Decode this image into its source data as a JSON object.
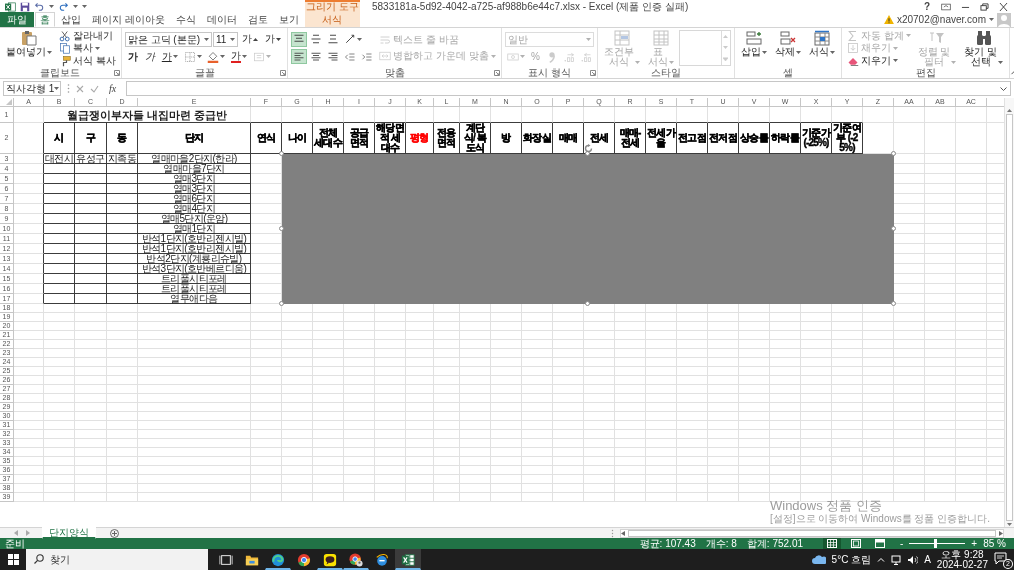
{
  "title_bar": {
    "title": "5833181a-5d92-4042-a725-af988b6e44c7.xlsx - Excel (제품 인증 실패)",
    "context_label": "그리기 도구",
    "help": "?"
  },
  "tabs": [
    {
      "label": "파일",
      "kind": "file",
      "selected": false
    },
    {
      "label": "홈",
      "kind": "normal",
      "selected": true
    },
    {
      "label": "삽입",
      "kind": "normal",
      "selected": false
    },
    {
      "label": "페이지 레이아웃",
      "kind": "normal",
      "selected": false
    },
    {
      "label": "수식",
      "kind": "normal",
      "selected": false
    },
    {
      "label": "데이터",
      "kind": "normal",
      "selected": false
    },
    {
      "label": "검토",
      "kind": "normal",
      "selected": false
    },
    {
      "label": "보기",
      "kind": "normal",
      "selected": false
    },
    {
      "label": "서식",
      "kind": "contextual",
      "selected": false
    }
  ],
  "account": {
    "user": "x20702@naver.com"
  },
  "ribbon": {
    "groups": [
      {
        "label": "클립보드",
        "launcher": true,
        "columns": [
          [
            [
              {
                "kind": "large",
                "label": "붙여넣기",
                "dropdown": true,
                "disabled": false
              }
            ]
          ],
          [
            [
              {
                "kind": "small",
                "label": "잘라내기",
                "dropdown": false,
                "disabled": false
              }
            ],
            [
              {
                "kind": "small",
                "label": "복사",
                "dropdown": true,
                "disabled": false
              }
            ],
            [
              {
                "kind": "small",
                "label": "서식 복사",
                "dropdown": false,
                "disabled": false
              }
            ]
          ]
        ]
      },
      {
        "label": "글꼴",
        "launcher": true,
        "columns": [
          [
            [
              {
                "kind": "field",
                "value": "맑은 고딕 (본문)",
                "disabled": false
              },
              {
                "kind": "field",
                "value": "11",
                "disabled": false
              },
              {
                "kind": "grow",
                "label": "가",
                "dropdown": false,
                "disabled": false
              },
              {
                "kind": "shrink",
                "label": "가",
                "dropdown": false,
                "disabled": false
              }
            ],
            [
              {
                "kind": "bold",
                "label": "가",
                "dropdown": false,
                "disabled": false
              },
              {
                "kind": "italic",
                "label": "가",
                "dropdown": false,
                "disabled": false
              },
              {
                "kind": "underline",
                "label": "가",
                "dropdown": true,
                "disabled": false
              },
              {
                "kind": "icon",
                "dropdown": true,
                "disabled": false,
                "selected": false
              },
              {
                "kind": "icon",
                "dropdown": true,
                "disabled": false,
                "selected": false
              },
              {
                "kind": "fontcolor",
                "label": "가",
                "dropdown": true,
                "disabled": false
              },
              {
                "kind": "icon",
                "dropdown": true,
                "disabled": true,
                "selected": false
              }
            ]
          ]
        ]
      },
      {
        "label": "맞춤",
        "launcher": true,
        "columns": [
          [
            [
              {
                "kind": "icon",
                "dropdown": false,
                "disabled": false,
                "selected": true
              },
              {
                "kind": "icon",
                "dropdown": false,
                "disabled": false,
                "selected": false
              },
              {
                "kind": "icon",
                "dropdown": false,
                "disabled": false,
                "selected": false
              },
              {
                "kind": "icon",
                "dropdown": true,
                "disabled": false,
                "selected": false
              }
            ],
            [
              {
                "kind": "icon",
                "dropdown": false,
                "disabled": false,
                "selected": true
              },
              {
                "kind": "icon",
                "dropdown": false,
                "disabled": false,
                "selected": false
              },
              {
                "kind": "icon",
                "dropdown": false,
                "disabled": false,
                "selected": false
              },
              {
                "kind": "icon",
                "dropdown": false,
                "disabled": false,
                "selected": false
              },
              {
                "kind": "icon",
                "dropdown": false,
                "disabled": false,
                "selected": false
              }
            ]
          ],
          [
            [
              {
                "kind": "small",
                "label": "텍스트 줄 바꿈",
                "dropdown": false,
                "disabled": true
              }
            ],
            [
              {
                "kind": "small",
                "label": "병합하고 가운데 맞춤",
                "dropdown": true,
                "disabled": true
              }
            ]
          ]
        ]
      },
      {
        "label": "표시 형식",
        "launcher": true,
        "columns": [
          [
            [
              {
                "kind": "field",
                "value": "일반",
                "disabled": true
              }
            ],
            [
              {
                "kind": "icon",
                "dropdown": true,
                "disabled": true,
                "selected": false
              },
              {
                "kind": "symbol",
                "label": "%",
                "dropdown": false,
                "disabled": true
              },
              {
                "kind": "icon",
                "dropdown": false,
                "disabled": true,
                "selected": false
              },
              {
                "kind": "icon",
                "dropdown": false,
                "disabled": true,
                "selected": false
              },
              {
                "kind": "icon",
                "dropdown": false,
                "disabled": true,
                "selected": false
              }
            ]
          ]
        ]
      },
      {
        "label": "스타일",
        "launcher": false,
        "columns": [
          [
            [
              {
                "kind": "large",
                "label": "조건부\n서식",
                "dropdown": true,
                "disabled": true
              }
            ]
          ],
          [
            [
              {
                "kind": "large",
                "label": "표\n서식",
                "dropdown": true,
                "disabled": true
              }
            ]
          ],
          [
            [
              {
                "kind": "gallery",
                "disabled": true
              }
            ]
          ]
        ]
      },
      {
        "label": "셀",
        "launcher": false,
        "columns": [
          [
            [
              {
                "kind": "large",
                "label": "삽입",
                "dropdown": true,
                "disabled": false
              }
            ]
          ],
          [
            [
              {
                "kind": "large",
                "label": "삭제",
                "dropdown": true,
                "disabled": false
              }
            ]
          ],
          [
            [
              {
                "kind": "large",
                "label": "서식",
                "dropdown": true,
                "disabled": false
              }
            ]
          ]
        ]
      },
      {
        "label": "편집",
        "launcher": false,
        "columns": [
          [
            [
              {
                "kind": "small",
                "label": "자동 합계",
                "dropdown": true,
                "disabled": true
              }
            ],
            [
              {
                "kind": "small",
                "label": "채우기",
                "dropdown": true,
                "disabled": true
              }
            ],
            [
              {
                "kind": "small",
                "label": "지우기",
                "dropdown": true,
                "disabled": false
              }
            ]
          ],
          [
            [
              {
                "kind": "large",
                "label": "정렬 및\n필터",
                "dropdown": true,
                "disabled": true
              }
            ]
          ],
          [
            [
              {
                "kind": "large",
                "label": "찾기 및\n선택",
                "dropdown": true,
                "disabled": false
              }
            ]
          ]
        ]
      }
    ]
  },
  "formula_bar": {
    "name_box": "직사각형 1",
    "function_label": "fx"
  },
  "sheet": {
    "columns": [
      "A",
      "B",
      "C",
      "D",
      "E",
      "F",
      "G",
      "H",
      "I",
      "J",
      "K",
      "L",
      "M",
      "N",
      "O",
      "P",
      "Q",
      "R",
      "S",
      "T",
      "U",
      "V",
      "W",
      "X",
      "Y",
      "Z",
      "AA",
      "AB",
      "AC"
    ],
    "title_row": {
      "number": "1",
      "title": "월급쟁이부자들 내집마련 중급반"
    },
    "header_row": {
      "number": "2",
      "headers": [
        {
          "text": "시",
          "color": "#000000"
        },
        {
          "text": "구",
          "color": "#000000"
        },
        {
          "text": "동",
          "color": "#000000"
        },
        {
          "text": "단지",
          "color": "#000000"
        },
        {
          "text": "연식",
          "color": "#000000"
        },
        {
          "text": "나이",
          "color": "#000000"
        },
        {
          "text": "전체 세대수",
          "color": "#000000"
        },
        {
          "text": "공급 면적",
          "color": "#000000"
        },
        {
          "text": "해당면적 세대수",
          "color": "#000000"
        },
        {
          "text": "평형",
          "color": "#ff0000"
        },
        {
          "text": "전용면적",
          "color": "#000000"
        },
        {
          "text": "계단식/ 복도식",
          "color": "#000000"
        },
        {
          "text": "방",
          "color": "#000000"
        },
        {
          "text": "화장실",
          "color": "#000000"
        },
        {
          "text": "매매",
          "color": "#000000"
        },
        {
          "text": "전세",
          "color": "#000000"
        },
        {
          "text": "매매-전세",
          "color": "#000000"
        },
        {
          "text": "전세가율",
          "color": "#000000"
        },
        {
          "text": "전고점",
          "color": "#000000"
        },
        {
          "text": "전저점",
          "color": "#000000"
        },
        {
          "text": "상승률",
          "color": "#000000"
        },
        {
          "text": "하락률",
          "color": "#000000"
        },
        {
          "text": "기준가 (-25%)",
          "color": "#000000"
        },
        {
          "text": "기준여부 (-25%)",
          "color": "#000000"
        }
      ]
    },
    "data_rows": [
      {
        "number": "3",
        "city": "대전시",
        "district": "유성구",
        "dong": "지족동",
        "complex": "열매마을2단지(한라)"
      },
      {
        "number": "4",
        "complex": "열매마을7단지"
      },
      {
        "number": "5",
        "complex": "열매3단지"
      },
      {
        "number": "6",
        "complex": "열매3단지"
      },
      {
        "number": "7",
        "complex": "열매6단지"
      },
      {
        "number": "8",
        "complex": "열매4단지"
      },
      {
        "number": "9",
        "complex": "열매5단지(운암)"
      },
      {
        "number": "10",
        "complex": "열매1단지"
      },
      {
        "number": "11",
        "complex": "반석1단지(호반리젠시빌)"
      },
      {
        "number": "12",
        "complex": "반석1단지(호반리젠시빌)"
      },
      {
        "number": "13",
        "complex": "반석2단지(계룡리슈빌)"
      },
      {
        "number": "14",
        "complex": "반석3단지(호반베르디움)"
      },
      {
        "number": "15",
        "complex": "트리풀시티포레"
      },
      {
        "number": "16",
        "complex": "트리풀시티포레"
      },
      {
        "number": "17",
        "complex": "열무애다음"
      }
    ],
    "empty_rows": [
      "18",
      "19",
      "20",
      "21",
      "22",
      "23",
      "24",
      "25",
      "26",
      "27",
      "28",
      "29",
      "30",
      "31",
      "32",
      "33",
      "34",
      "35",
      "36",
      "37",
      "38",
      "39"
    ],
    "shape": {
      "kind": "rectangle",
      "selected": true
    }
  },
  "activation_notice": {
    "title": "Windows 정품 인증",
    "message": "[설정]으로 이동하여 Windows를 정품 인증합니다."
  },
  "sheet_tabs": [
    {
      "label": "단지양식",
      "selected": true
    }
  ],
  "status_bar": {
    "mode": "준비",
    "average": "평균: 107.43",
    "count": "개수: 8",
    "sum": "합계: 752.01",
    "views": [
      {
        "selected": true
      },
      {
        "selected": false
      },
      {
        "selected": false
      }
    ],
    "zoom": {
      "minus": "-",
      "plus": "+",
      "level": 0.45,
      "percent": "85 %"
    }
  },
  "taskbar": {
    "search_placeholder": "찾기",
    "apps": [
      {
        "kind": "task-view",
        "running": false,
        "active": false
      },
      {
        "kind": "folder",
        "running": false,
        "active": false
      },
      {
        "kind": "swirl",
        "running": true,
        "active": false
      },
      {
        "kind": "wheel",
        "running": false,
        "active": false
      },
      {
        "kind": "bubble",
        "running": true,
        "active": false
      },
      {
        "kind": "wheel-profile",
        "running": true,
        "active": false
      },
      {
        "kind": "e-globe",
        "running": false,
        "active": false
      },
      {
        "kind": "sheet",
        "running": true,
        "active": true
      }
    ],
    "weather": "5°C 흐림",
    "ime": "A",
    "time": "오후 9:28",
    "date": "2024-02-27",
    "notifications": "2"
  }
}
